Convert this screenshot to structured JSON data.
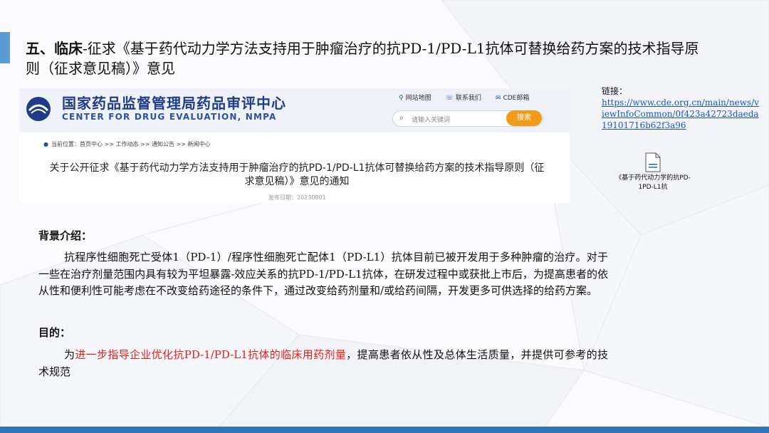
{
  "slide": {
    "title_bold": "五、临床",
    "title_rest": "-征求《基于药代动力学方法支持用于肿瘤治疗的抗PD-1/PD-L1抗体可替换给药方案的技术指导原则（征求意见稿）》意见"
  },
  "screenshot": {
    "org_cn": "国家药品监督管理局药品审评中心",
    "org_en": "CENTER FOR DRUG EVALUATION, NMPA",
    "top_links": [
      "网站地图",
      "联系我们",
      "CDE邮箱"
    ],
    "search_placeholder": "请输入关键词",
    "search_button": "搜索",
    "breadcrumb": "当前位置：首页中心 >> 工作动态 >> 通知公告 >> 新闻中心",
    "notice_title": "关于公开征求《基于药代动力学方法支持用于肿瘤治疗的抗PD-1/PD-L1抗体可替换给药方案的技术指导原则（征求意见稿）》意见的通知",
    "publish_date": "发布日期：20230801"
  },
  "link": {
    "label": "链接：",
    "url": "https://www.cde.org.cn/main/news/viewInfoCommon/0f423a42723daeda19101716b62f3a96"
  },
  "attachment": {
    "name": "《基于药代动力学的抗PD-1PD-L1抗"
  },
  "background": {
    "heading": "背景介绍：",
    "text": "抗程序性细胞死亡受体1（PD-1）/程序性细胞死亡配体1（PD-L1）抗体目前已被开发用于多种肿瘤的治疗。对于一些在治疗剂量范围内具有较为平坦暴露-效应关系的抗PD-1/PD-L1抗体，在研发过程中或获批上市后，为提高患者的依从性和便利性可能考虑在不改变给药途径的条件下，通过改变给药剂量和/或给药间隔，开发更多可供选择的给药方案。"
  },
  "purpose": {
    "heading": "目的：",
    "prefix": "为",
    "highlight": "进一步指导企业优化抗PD-1/PD-L1抗体的临床用药剂量",
    "suffix": "，提高患者依从性及总体生活质量，并提供可参考的技术规范"
  },
  "colors": {
    "accent_bar": "#5b9bd5",
    "bottom_bar": "#2e75b6",
    "highlight_red": "#e3211c",
    "link_blue": "#1a56c8",
    "search_orange": "#f49a1a"
  }
}
